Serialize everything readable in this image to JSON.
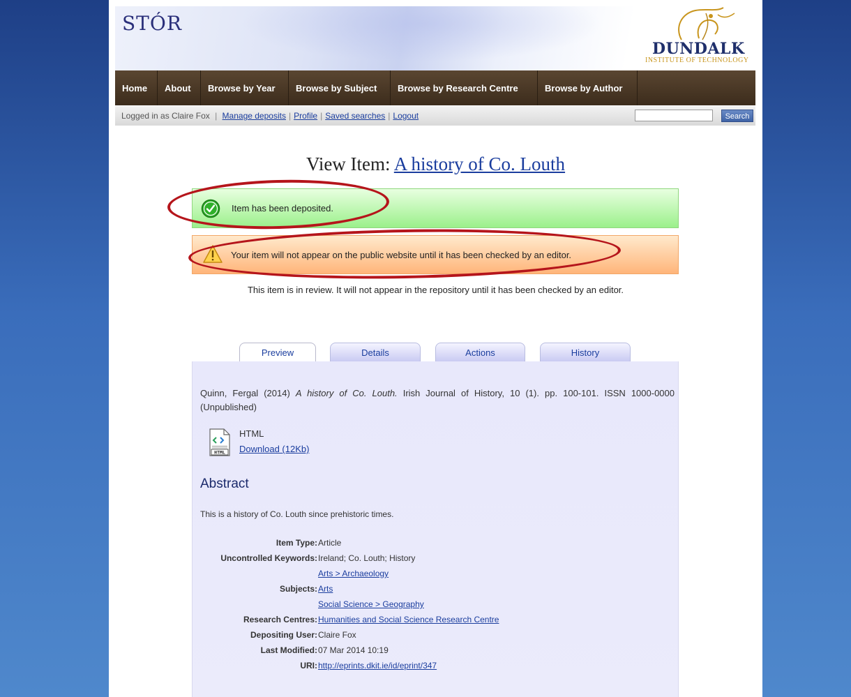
{
  "header": {
    "site_title": "STÓR",
    "logo_name": "DUNDALK",
    "logo_sub": "INSTITUTE OF TECHNOLOGY"
  },
  "nav": {
    "items": [
      "Home",
      "About",
      "Browse by Year",
      "Browse by Subject",
      "Browse by Research Centre",
      "Browse by Author"
    ]
  },
  "userbar": {
    "logged_in": "Logged in as Claire Fox",
    "links": [
      "Manage deposits",
      "Profile",
      "Saved searches",
      "Logout"
    ],
    "search_value": "",
    "search_button": "Search"
  },
  "page": {
    "title_prefix": "View Item:",
    "title_link": "A history of Co. Louth"
  },
  "messages": {
    "success": "Item has been deposited.",
    "warning": "Your item will not appear on the public website until it has been checked by an editor.",
    "review_note": "This item is in review. It will not appear in the repository until it has been checked by an editor."
  },
  "tabs": [
    "Preview",
    "Details",
    "Actions",
    "History"
  ],
  "preview": {
    "citation_authors": "Quinn, Fergal (2014)",
    "citation_title": "A history of Co. Louth.",
    "citation_rest": "Irish Journal of History, 10 (1). pp. 100-101. ISSN 1000-0000 (Unpublished)",
    "doc_format": "HTML",
    "doc_download": "Download (12Kb)",
    "abstract_heading": "Abstract",
    "abstract_text": "This is a history of Co. Louth since prehistoric times."
  },
  "metadata": {
    "item_type_label": "Item Type:",
    "item_type": "Article",
    "keywords_label": "Uncontrolled Keywords:",
    "keywords": "Ireland; Co. Louth; History",
    "subjects_label": "Subjects:",
    "subjects": [
      "Arts > Archaeology",
      "Arts",
      "Social Science > Geography"
    ],
    "research_centres_label": "Research Centres:",
    "research_centres": "Humanities and Social Science Research Centre",
    "depositing_user_label": "Depositing User:",
    "depositing_user": "Claire Fox",
    "last_modified_label": "Last Modified:",
    "last_modified": "07 Mar 2014 10:19",
    "uri_label": "URI:",
    "uri": "http://eprints.dkit.ie/id/eprint/347"
  },
  "colors": {
    "annotation_ellipse": "#b5151b",
    "link": "#1a3d9e",
    "navbar": "#4a3826"
  }
}
